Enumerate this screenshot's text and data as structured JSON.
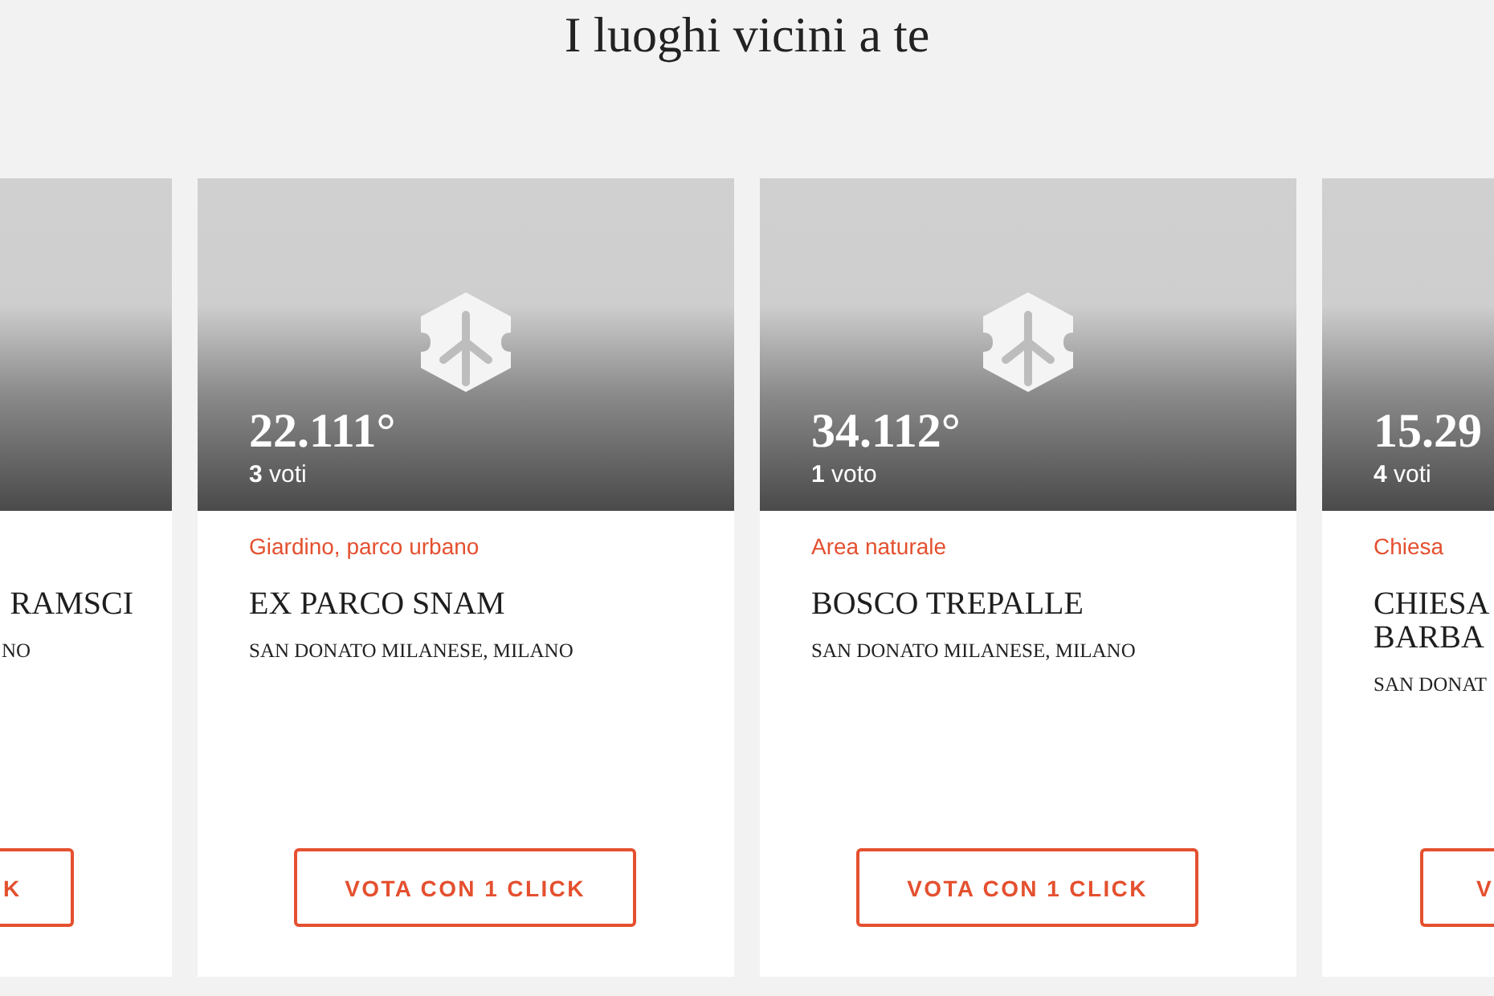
{
  "title": "I luoghi vicini a te",
  "cards": [
    {
      "kind": "cut-left",
      "name_lines": [
        "RAMSCI"
      ],
      "location": "NO",
      "button": "K"
    },
    {
      "kind": "full",
      "score": "22.111°",
      "votes": "**3** voti",
      "category": "Giardino, parco urbano",
      "name_lines": [
        "EX PARCO SNAM"
      ],
      "location": "SAN DONATO MILANESE, MILANO",
      "button": "VOTA CON 1 CLICK"
    },
    {
      "kind": "full",
      "score": "34.112°",
      "votes": "**1** voto",
      "category": "Area naturale",
      "name_lines": [
        "BOSCO TREPALLE"
      ],
      "location": "SAN DONATO MILANESE, MILANO",
      "button": "VOTA CON 1 CLICK"
    },
    {
      "kind": "cut-right",
      "score": "15.29",
      "votes": "**4** voti",
      "category": "Chiesa",
      "name_lines": [
        "CHIESA",
        "BARBA"
      ],
      "location": "SAN DONAT",
      "button": "V"
    }
  ]
}
